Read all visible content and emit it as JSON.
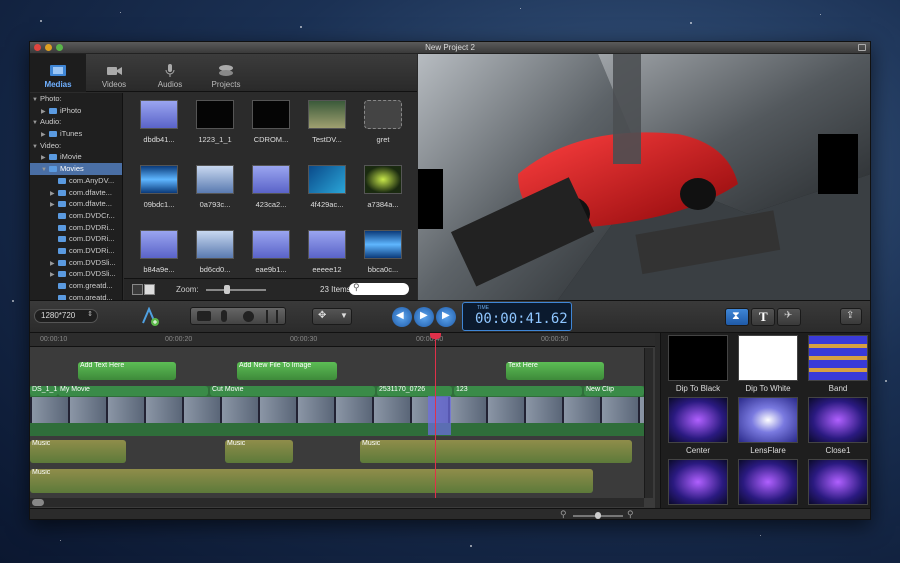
{
  "window": {
    "title": "New Project 2"
  },
  "library": {
    "tabs": [
      {
        "label": "Medias",
        "icon": "film-strip-icon",
        "active": true
      },
      {
        "label": "Videos",
        "icon": "video-camera-icon"
      },
      {
        "label": "Audios",
        "icon": "microphone-icon"
      },
      {
        "label": "Projects",
        "icon": "film-reel-icon"
      }
    ],
    "tree": [
      {
        "label": "Photo:",
        "level": 0,
        "arrow": "▼"
      },
      {
        "label": "iPhoto",
        "level": 1,
        "arrow": "▶"
      },
      {
        "label": "Audio:",
        "level": 0,
        "arrow": "▼"
      },
      {
        "label": "iTunes",
        "level": 1,
        "arrow": "▶"
      },
      {
        "label": "Video:",
        "level": 0,
        "arrow": "▼"
      },
      {
        "label": "iMovie",
        "level": 1,
        "arrow": "▶"
      },
      {
        "label": "Movies",
        "level": 1,
        "arrow": "▼",
        "selected": true
      },
      {
        "label": "com.AnyDV...",
        "level": 2,
        "arrow": ""
      },
      {
        "label": "com.dfavte...",
        "level": 2,
        "arrow": "▶"
      },
      {
        "label": "com.dfavte...",
        "level": 2,
        "arrow": "▶"
      },
      {
        "label": "com.DVDCr...",
        "level": 2,
        "arrow": ""
      },
      {
        "label": "com.DVDRi...",
        "level": 2,
        "arrow": ""
      },
      {
        "label": "com.DVDRi...",
        "level": 2,
        "arrow": ""
      },
      {
        "label": "com.DVDRi...",
        "level": 2,
        "arrow": ""
      },
      {
        "label": "com.DVDSli...",
        "level": 2,
        "arrow": "▶"
      },
      {
        "label": "com.DVDSli...",
        "level": 2,
        "arrow": "▶"
      },
      {
        "label": "com.greatd...",
        "level": 2,
        "arrow": ""
      },
      {
        "label": "com.greatd...",
        "level": 2,
        "arrow": ""
      }
    ],
    "media": [
      {
        "label": "dbdb41...",
        "thumb": "purple"
      },
      {
        "label": "1223_1_1",
        "thumb": "black"
      },
      {
        "label": "CDROM...",
        "thumb": "black"
      },
      {
        "label": "TestDV...",
        "thumb": "scene"
      },
      {
        "label": "gret",
        "thumb": "empty"
      },
      {
        "label": "09bdc1...",
        "thumb": "blue"
      },
      {
        "label": "0a793c...",
        "thumb": "sky"
      },
      {
        "label": "423ca2...",
        "thumb": "purple"
      },
      {
        "label": "4f429ac...",
        "thumb": "teal"
      },
      {
        "label": "a7384a...",
        "thumb": "green"
      },
      {
        "label": "b84a9e...",
        "thumb": "purple"
      },
      {
        "label": "bd6cd0...",
        "thumb": "sky"
      },
      {
        "label": "eae9b1...",
        "thumb": "purple"
      },
      {
        "label": "eeeee12",
        "thumb": "purple"
      },
      {
        "label": "bbca0c...",
        "thumb": "blue"
      }
    ],
    "zoom_label": "Zoom:",
    "item_count": "23 Items",
    "search_placeholder": ""
  },
  "toolbar": {
    "resolution": "1280*720",
    "timecode_label": "TIME",
    "timecode": "00:00:41.62"
  },
  "timeline": {
    "ruler": [
      "00:00:10",
      "00:00:20",
      "00:00:30",
      "00:00:40",
      "00:00:50"
    ],
    "text_clips": [
      "Add Text Here",
      "Add New File To Image",
      "Text Here"
    ],
    "video_clips": [
      "DS_1_1",
      "My Movie",
      "Cut Movie",
      "2531170_0726",
      "123",
      "New Clip"
    ],
    "music_clips": [
      "Music",
      "Music",
      "Music",
      "Music"
    ]
  },
  "transitions": [
    {
      "label": "Dip To Black",
      "thumb": "black"
    },
    {
      "label": "Dip To White",
      "thumb": "white"
    },
    {
      "label": "Band",
      "thumb": "band"
    },
    {
      "label": "Center",
      "thumb": "stage"
    },
    {
      "label": "LensFlare",
      "thumb": "flare"
    },
    {
      "label": "Close1",
      "thumb": "stage"
    },
    {
      "label": "",
      "thumb": "stage"
    },
    {
      "label": "",
      "thumb": "stage"
    },
    {
      "label": "",
      "thumb": "stage"
    }
  ],
  "colors": {
    "accent_blue": "#3f86d6",
    "text_track": "#4fa84a",
    "video_track": "#2f6e3a",
    "music_track": "#8a8a3a",
    "playhead": "#e0304a"
  }
}
